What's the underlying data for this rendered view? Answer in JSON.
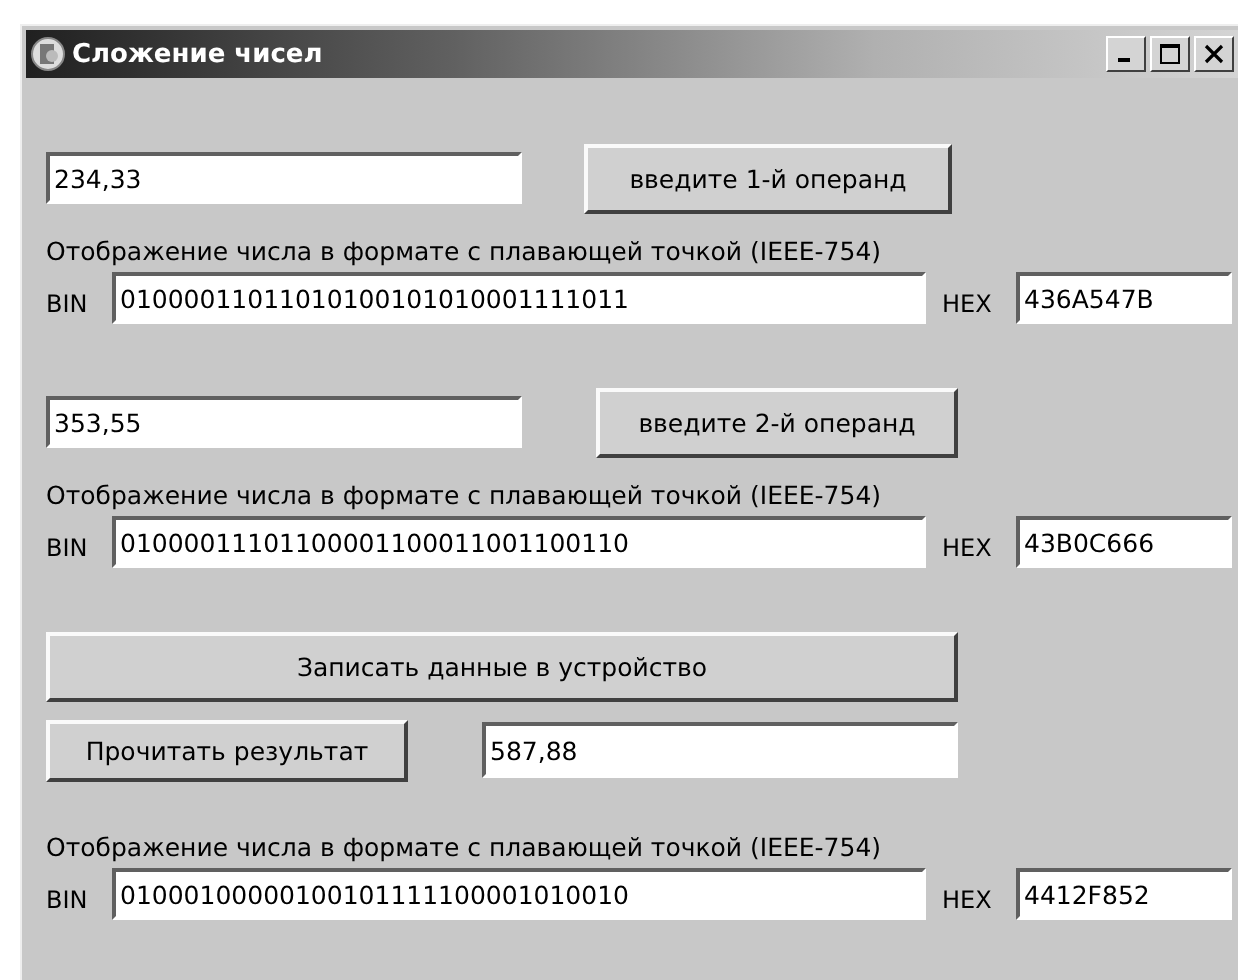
{
  "window": {
    "title": "Сложение чисел"
  },
  "operands": [
    {
      "value": "234,33",
      "button": "введите 1-й операнд",
      "caption": "Отображение числа в формате с плавающей точкой (IEEE-754)",
      "bin_label": "BIN",
      "bin": "01000011011010100101010001111011",
      "hex_label": "HEX",
      "hex": "436A547B"
    },
    {
      "value": "353,55",
      "button": "введите 2-й операнд",
      "caption": "Отображение числа в формате с плавающей точкой (IEEE-754)",
      "bin_label": "BIN",
      "bin": "01000011101100001100011001100110",
      "hex_label": "HEX",
      "hex": "43B0C666"
    }
  ],
  "write_button": "Записать данные в устройство",
  "result": {
    "button": "Прочитать результат",
    "value": "587,88",
    "caption": "Отображение числа в формате с плавающей точкой (IEEE-754)",
    "bin_label": "BIN",
    "bin": "01000100000100101111100001010010",
    "hex_label": "HEX",
    "hex": "4412F852"
  }
}
